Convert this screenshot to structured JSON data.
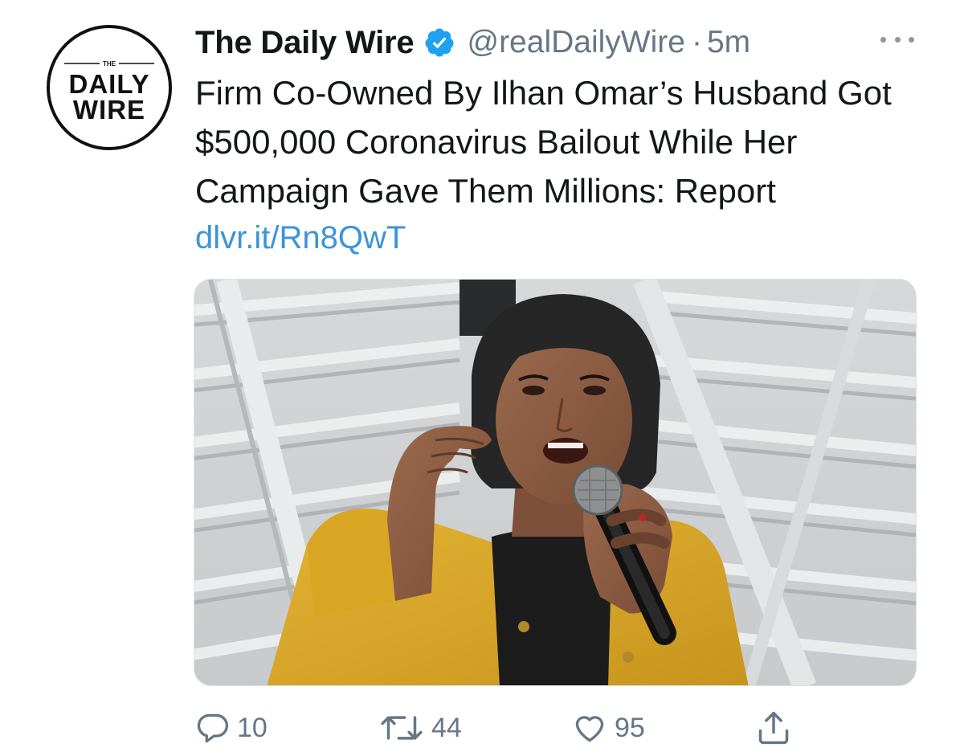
{
  "author": {
    "display_name": "The Daily Wire",
    "handle": "@realDailyWire",
    "separator": "·",
    "time": "5m",
    "verified": true,
    "avatar": {
      "logo_text_top": "THE",
      "logo_line1": "DAILY",
      "logo_line2": "WIRE"
    }
  },
  "tweet": {
    "text": "Firm Co-Owned By Ilhan Omar’s Husband Got $500,000 Coronavirus Bailout While Her Campaign Gave Them Millions: Report",
    "link": "dlvr.it/Rn8QwT"
  },
  "actions": {
    "replies": "10",
    "retweets": "44",
    "likes": "95"
  },
  "icons": {
    "verified": "verified-badge-icon",
    "more": "more-options-icon",
    "reply": "reply-icon",
    "retweet": "retweet-icon",
    "like": "heart-icon",
    "share": "share-icon"
  },
  "colors": {
    "accent_blue": "#1da1f2",
    "link_blue": "#3b94d9",
    "secondary_text": "#657786",
    "jacket_yellow": "#d9a623"
  }
}
